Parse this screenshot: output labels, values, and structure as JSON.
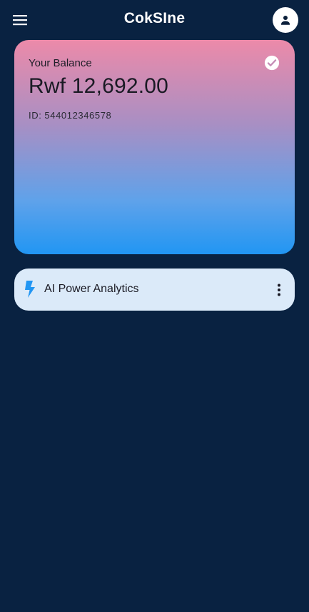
{
  "app": {
    "title": "CokSIne"
  },
  "header": {
    "menu_icon": "menu-icon",
    "profile_icon": "person-icon"
  },
  "balance_card": {
    "label": "Your Balance",
    "amount": "Rwf 12,692.00",
    "id_label": "ID:",
    "id_value": "544012346578",
    "status_icon": "check-circle-icon",
    "gradient_colors": [
      "#ec8aa9",
      "#2196f3"
    ]
  },
  "feature_card": {
    "icon": "bolt-icon",
    "label": "AI Power Analytics",
    "menu_icon": "more-vert-icon",
    "icon_color": "#2196f3"
  },
  "colors": {
    "background": "#092241",
    "feature_card_bg": "#dbeaf9"
  }
}
